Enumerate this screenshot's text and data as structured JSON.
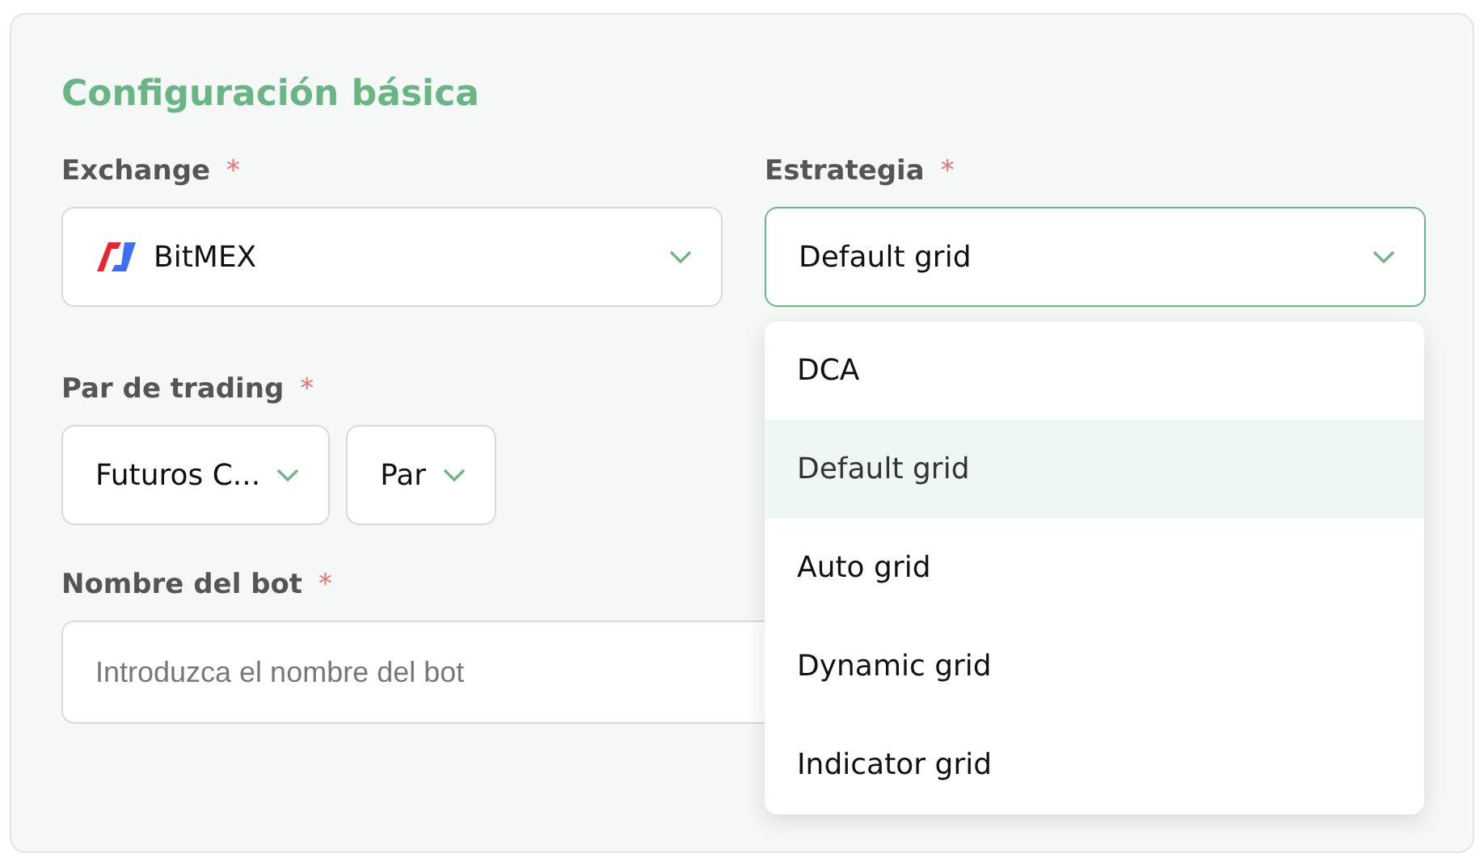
{
  "section_title": "Configuración básica",
  "exchange": {
    "label": "Exchange",
    "required_mark": "*",
    "value": "BitMEX"
  },
  "strategy": {
    "label": "Estrategia",
    "required_mark": "*",
    "value": "Default grid",
    "focused": true,
    "expanded": true,
    "options": [
      {
        "label": "DCA",
        "selected": false
      },
      {
        "label": "Default grid",
        "selected": true
      },
      {
        "label": "Auto grid",
        "selected": false
      },
      {
        "label": "Dynamic grid",
        "selected": false
      },
      {
        "label": "Indicator grid",
        "selected": false
      }
    ]
  },
  "trading_pair": {
    "label": "Par de trading",
    "required_mark": "*",
    "market": "Futuros C...",
    "pair": "Par"
  },
  "bot_name": {
    "label": "Nombre del bot",
    "required_mark": "*",
    "placeholder": "Introduzca el nombre del bot"
  }
}
